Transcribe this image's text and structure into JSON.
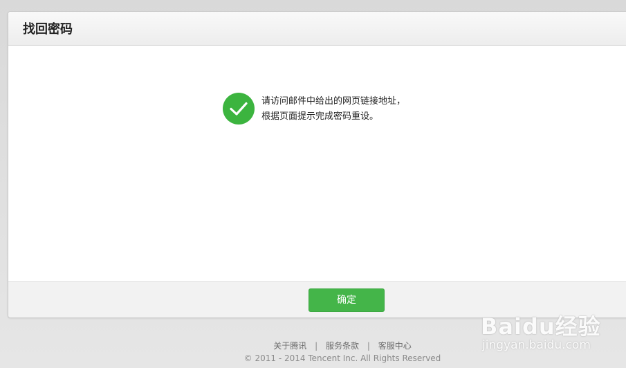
{
  "header": {
    "title": "找回密码"
  },
  "message": {
    "line1": "请访问邮件中给出的网页链接地址，",
    "line2": "根据页面提示完成密码重设。"
  },
  "actions": {
    "confirm_label": "确定"
  },
  "footer": {
    "links": [
      "关于腾讯",
      "服务条款",
      "客服中心"
    ],
    "separator": "|",
    "copyright": "© 2011 - 2014 Tencent Inc. All Rights Reserved"
  },
  "watermark": {
    "logo": "Baidu经验",
    "url": "jingyan.baidu.com"
  },
  "colors": {
    "success_green": "#3cb43f",
    "button_green": "#44b549"
  },
  "icons": {
    "status": "check-circle-icon"
  }
}
